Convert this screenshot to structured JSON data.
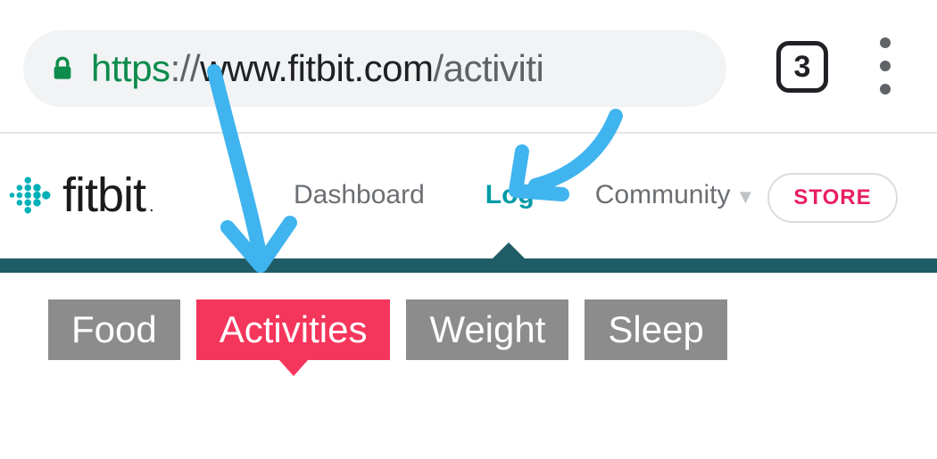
{
  "browser": {
    "url_scheme": "https",
    "url_sep": "://",
    "url_host": "www.fitbit.com",
    "url_path": "/activiti",
    "tab_count": "3"
  },
  "brand": {
    "name": "fitbit",
    "dot": "."
  },
  "nav": {
    "dashboard": "Dashboard",
    "log": "Log",
    "community": "Community",
    "store": "STORE"
  },
  "subtabs": {
    "food": "Food",
    "activities": "Activities",
    "weight": "Weight",
    "sleep": "Sleep"
  },
  "colors": {
    "teal": "#00b0b9",
    "pink": "#f5365c",
    "arrow": "#3fb4ef"
  }
}
